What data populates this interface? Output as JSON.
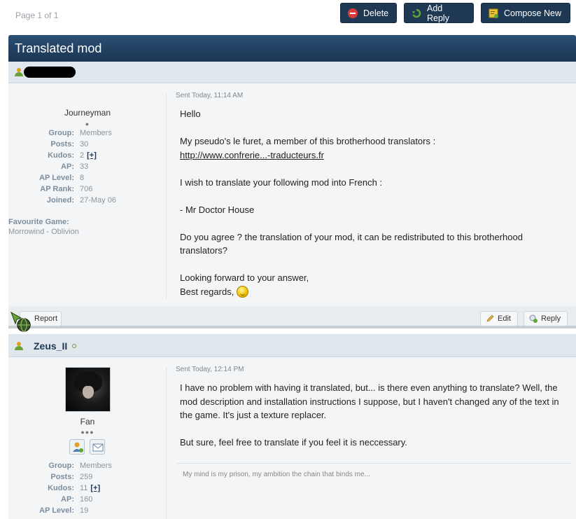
{
  "toolbar": {
    "page_info": "Page 1 of 1",
    "delete_label": "Delete",
    "add_reply_label": "Add Reply",
    "compose_new_label": "Compose New",
    "colors": {
      "button_bg": "#1f3954",
      "delete_icon": "#d83b3b",
      "reply_icon": "#5fa838",
      "compose_icon": "#e8c23a"
    }
  },
  "thread": {
    "title": "Translated mod"
  },
  "posts": [
    {
      "author": "",
      "author_redacted": true,
      "rank": "Journeyman",
      "pips": "●",
      "stats": [
        {
          "label": "Group:",
          "value": "Members"
        },
        {
          "label": "Posts:",
          "value": "30"
        },
        {
          "label": "Kudos:",
          "value": "2",
          "extra": "[+]"
        },
        {
          "label": "AP:",
          "value": "33"
        },
        {
          "label": "AP Level:",
          "value": "8"
        },
        {
          "label": "AP Rank:",
          "value": "706"
        },
        {
          "label": "Joined:",
          "value": "27-May 06"
        }
      ],
      "favourite_game_label": "Favourite Game:",
      "favourite_game": "Morrowind - Oblivion",
      "sent": "Sent Today, 11:14 AM",
      "body": [
        "Hello",
        "",
        "My pseudo's le furet, a member of this brotherhood translators :",
        "",
        "",
        "I wish to translate your following mod into French :",
        "",
        "- Mr Doctor House",
        "",
        "Do you agree ? the translation of your mod, it can be redistributed to this brotherhood",
        "translators?",
        "",
        "Looking forward to your answer,",
        "Best regards,"
      ],
      "link": "http://www.confrerie...-traducteurs.fr",
      "report_label": "Report",
      "edit_label": "Edit",
      "reply_label": "Reply"
    },
    {
      "author": "Zeus_II",
      "rank": "Fan",
      "pips": "●●●",
      "stats": [
        {
          "label": "Group:",
          "value": "Members"
        },
        {
          "label": "Posts:",
          "value": "259"
        },
        {
          "label": "Kudos:",
          "value": "11",
          "extra": "[+]"
        },
        {
          "label": "AP:",
          "value": "160"
        },
        {
          "label": "AP Level:",
          "value": "19"
        }
      ],
      "sent": "Sent Today, 12:14 PM",
      "body": [
        "I have no problem with having it translated, but... is there even anything to translate? Well, the",
        "mod description and installation instructions I suppose, but I haven't changed any of the text in",
        "the game. It's just a texture replacer.",
        "",
        "But sure, feel free to translate if you feel it is neccessary."
      ],
      "signature": "My mind is my prison, my ambition the chain that binds me..."
    }
  ]
}
